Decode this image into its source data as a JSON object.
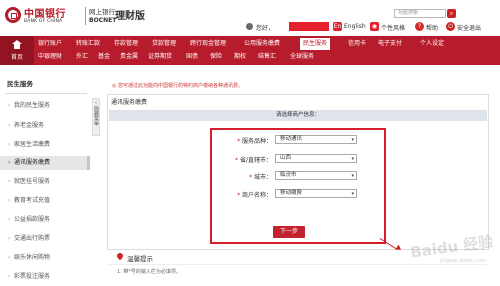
{
  "header": {
    "logo_cn": "中国银行",
    "logo_en": "BANK OF CHINA",
    "ebank": "网上银行",
    "bocnet": "BOCNET",
    "version": "理财版",
    "search_placeholder": "功能搜索",
    "greeting": "您好，",
    "lang": "English",
    "personalize": "个性风格",
    "help": "帮助",
    "logout": "安全退出"
  },
  "nav": {
    "home": "首页",
    "row1": [
      "银行账户",
      "转账汇款",
      "存款管理",
      "贷款管理",
      "跨行现金管理",
      "公用服务缴费",
      "民生服务",
      "信用卡",
      "电子支付",
      "个人设定"
    ],
    "row2": [
      "中银理财",
      "外汇",
      "基金",
      "贵金属",
      "证券期货",
      "国债",
      "保险",
      "期权",
      "结售汇",
      "全球服务"
    ],
    "active": "民生服务"
  },
  "sidebar": {
    "title": "民生服务",
    "items": [
      "我的民生服务",
      "养老金服务",
      "家居生活缴费",
      "通讯服务缴费",
      "就医挂号服务",
      "教育考试充值",
      "公益捐款服务",
      "交通出行购票",
      "娱乐休闲购物",
      "彩票投注服务"
    ],
    "active_index": 3,
    "collapse_label": "隐藏菜单"
  },
  "main": {
    "notice": "您可通过此功能向中国银行的特约商户缴纳各种通讯费。",
    "panel_title": "通讯服务缴费",
    "section_title": "请选择商户信息：",
    "form": [
      {
        "label": "服务品种：",
        "value": "移动通讯"
      },
      {
        "label": "省/直辖市：",
        "value": "山西"
      },
      {
        "label": "城市：",
        "value": "临汾市"
      },
      {
        "label": "商户名称：",
        "value": "移动缴费"
      }
    ],
    "next_button": "下一步",
    "tips_title": "温馨提示",
    "tips_text": "1. 带*号的输入栏为必填项。"
  },
  "watermark": "Baidu 经验",
  "watermark_url": "jingyan.baidu.com",
  "colors": {
    "brand_red": "#b71c2c",
    "highlight_red": "#d21f2b",
    "active_bg": "#e6e6e6"
  }
}
